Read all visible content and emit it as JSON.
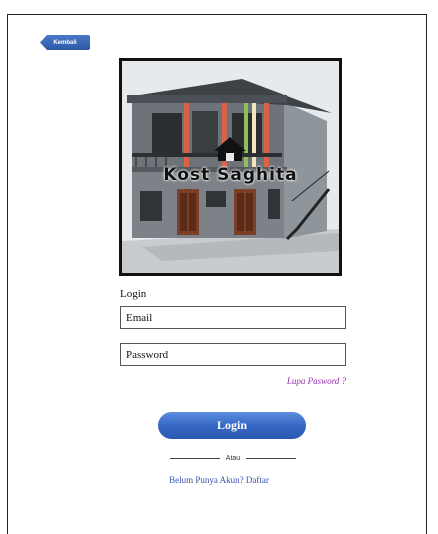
{
  "nav": {
    "back_label": "Kembali"
  },
  "hero": {
    "title": "Kost Saghita"
  },
  "form": {
    "heading": "Login",
    "email_placeholder": "Email",
    "password_placeholder": "Password",
    "forgot_label": "Lupa Pasword ?",
    "submit_label": "Login",
    "divider_label": "Atau",
    "register_label": "Belum Punya Akun? Daftar"
  },
  "colors": {
    "accent": "#3568c4",
    "forgot_link": "#9b2fb5",
    "register_link": "#3b52b4"
  }
}
